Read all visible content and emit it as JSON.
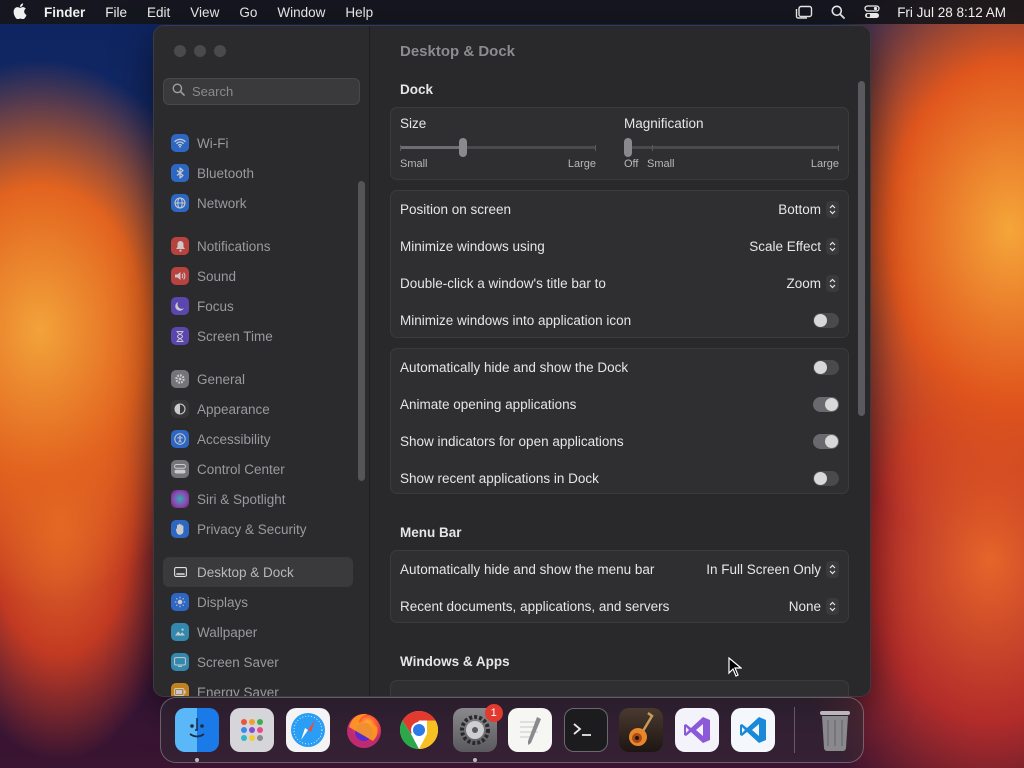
{
  "menubar": {
    "app_name": "Finder",
    "menus": [
      "File",
      "Edit",
      "View",
      "Go",
      "Window",
      "Help"
    ],
    "status_icons": [
      "stage-manager-icon",
      "search-icon",
      "control-center-icon"
    ],
    "clock": "Fri Jul 28  8:12 AM"
  },
  "sidebar": {
    "search_placeholder": "Search",
    "groups": [
      [
        {
          "label": "Wi-Fi",
          "icon": "wifi-icon",
          "color": "#2e7cf6"
        },
        {
          "label": "Bluetooth",
          "icon": "bluetooth-icon",
          "color": "#2e7cf6"
        },
        {
          "label": "Network",
          "icon": "globe-icon",
          "color": "#2e7cf6"
        }
      ],
      [
        {
          "label": "Notifications",
          "icon": "bell-icon",
          "color": "#e84a44"
        },
        {
          "label": "Sound",
          "icon": "speaker-icon",
          "color": "#e84a44"
        },
        {
          "label": "Focus",
          "icon": "moon-icon",
          "color": "#6a4fd8"
        },
        {
          "label": "Screen Time",
          "icon": "hourglass-icon",
          "color": "#6a4fd8"
        }
      ],
      [
        {
          "label": "General",
          "icon": "gear-icon",
          "color": "#8e8e93"
        },
        {
          "label": "Appearance",
          "icon": "appearance-icon",
          "color": "#3a3a3c"
        },
        {
          "label": "Accessibility",
          "icon": "accessibility-icon",
          "color": "#2e7cf6"
        },
        {
          "label": "Control Center",
          "icon": "control-center-icon",
          "color": "#8e8e93"
        },
        {
          "label": "Siri & Spotlight",
          "icon": "siri-icon",
          "color": "#b04ad8"
        },
        {
          "label": "Privacy & Security",
          "icon": "hand-icon",
          "color": "#2e7cf6"
        }
      ],
      [
        {
          "label": "Desktop & Dock",
          "icon": "dock-icon",
          "color": "#3a3a3c",
          "selected": true
        },
        {
          "label": "Displays",
          "icon": "sun-icon",
          "color": "#2e7cf6"
        },
        {
          "label": "Wallpaper",
          "icon": "wallpaper-icon",
          "color": "#35a8d8"
        },
        {
          "label": "Screen Saver",
          "icon": "screensaver-icon",
          "color": "#35a8d8"
        },
        {
          "label": "Energy Saver",
          "icon": "battery-icon",
          "color": "#f0a020"
        }
      ]
    ]
  },
  "content": {
    "title": "Desktop & Dock",
    "dock_section": "Dock",
    "size_slider": {
      "label": "Size",
      "min_label": "Small",
      "max_label": "Large",
      "value": 0.32
    },
    "magnification_slider": {
      "label": "Magnification",
      "off_label": "Off",
      "min_label": "Small",
      "max_label": "Large",
      "value": 0.0
    },
    "dock_popups": [
      {
        "label": "Position on screen",
        "value": "Bottom"
      },
      {
        "label": "Minimize windows using",
        "value": "Scale Effect"
      },
      {
        "label": "Double-click a window's title bar to",
        "value": "Zoom"
      }
    ],
    "minimize_into_icon": {
      "label": "Minimize windows into application icon",
      "on": false
    },
    "dock_toggles": [
      {
        "label": "Automatically hide and show the Dock",
        "on": false
      },
      {
        "label": "Animate opening applications",
        "on": true
      },
      {
        "label": "Show indicators for open applications",
        "on": true
      },
      {
        "label": "Show recent applications in Dock",
        "on": false
      }
    ],
    "menubar_section": "Menu Bar",
    "menubar_popups": [
      {
        "label": "Automatically hide and show the menu bar",
        "value": "In Full Screen Only"
      },
      {
        "label": "Recent documents, applications, and servers",
        "value": "None"
      }
    ],
    "windows_section": "Windows & Apps"
  },
  "dock": {
    "apps": [
      {
        "name": "Finder",
        "icon": "finder-icon",
        "glyph": "☺",
        "bg": "#1e8ef0",
        "running": true
      },
      {
        "name": "Launchpad",
        "icon": "launchpad-icon",
        "glyph": "⣿",
        "bg": "#d8d8dc",
        "running": false
      },
      {
        "name": "Safari",
        "icon": "safari-icon",
        "glyph": "✲",
        "bg": "#2a9df4",
        "running": false
      },
      {
        "name": "Firefox",
        "icon": "firefox-icon",
        "glyph": "●",
        "bg": "#7a3fe0",
        "running": false
      },
      {
        "name": "Chrome",
        "icon": "chrome-icon",
        "glyph": "◉",
        "bg": "#ffffff",
        "running": false
      },
      {
        "name": "System Settings",
        "icon": "system-settings-icon",
        "glyph": "⚙",
        "bg": "#6e6e72",
        "running": true,
        "badge": "1"
      },
      {
        "name": "TextEdit",
        "icon": "textedit-icon",
        "glyph": "✎",
        "bg": "#f4f4f2",
        "running": false
      },
      {
        "name": "Terminal",
        "icon": "terminal-icon",
        "glyph": ">_",
        "bg": "#1c1c1e",
        "running": false
      },
      {
        "name": "GarageBand",
        "icon": "garageband-icon",
        "glyph": "♪",
        "bg": "#3a2a22",
        "running": false
      },
      {
        "name": "Visual Studio",
        "icon": "visual-studio-icon",
        "glyph": "⋈",
        "bg": "#f4f2fa",
        "running": false
      },
      {
        "name": "Visual Studio Code",
        "icon": "vscode-icon",
        "glyph": "⋊",
        "bg": "#f4f8fc",
        "running": false
      }
    ],
    "trash": {
      "name": "Trash",
      "icon": "trash-icon"
    }
  }
}
